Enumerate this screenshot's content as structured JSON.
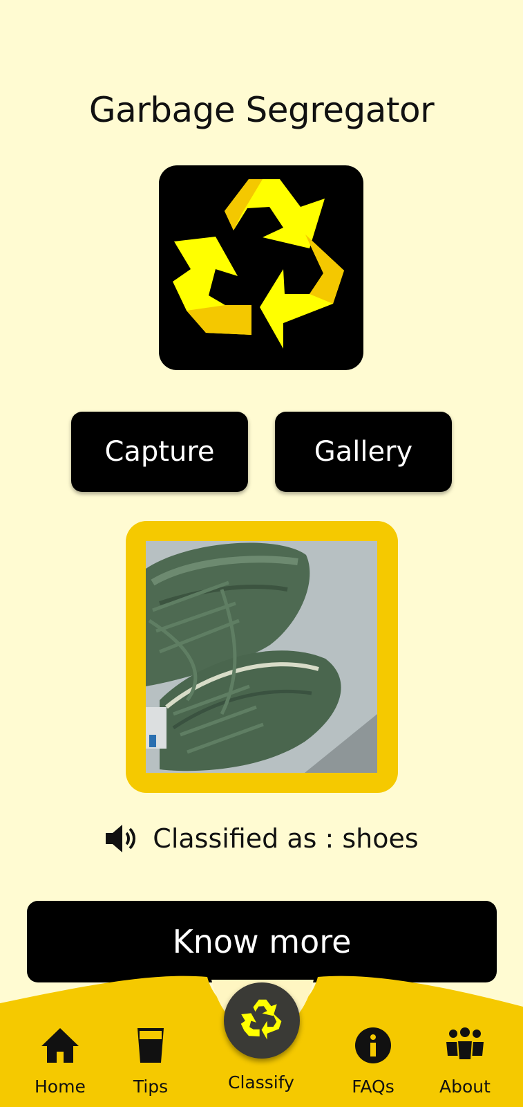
{
  "app": {
    "title": "Garbage Segregator"
  },
  "actions": {
    "capture_label": "Capture",
    "gallery_label": "Gallery",
    "know_more_label": "Know more"
  },
  "result": {
    "text": "Classified as : shoes",
    "icon": "speaker-icon"
  },
  "nav": {
    "items": [
      {
        "label": "Home",
        "icon": "home-icon"
      },
      {
        "label": "Tips",
        "icon": "glass-icon"
      },
      {
        "label": "Classify",
        "icon": "recycle-icon",
        "active": true
      },
      {
        "label": "FAQs",
        "icon": "info-icon"
      },
      {
        "label": "About",
        "icon": "people-icon"
      }
    ]
  },
  "colors": {
    "background": "#FFFBD2",
    "accent": "#F5C900",
    "button": "#000000",
    "text": "#111111"
  }
}
